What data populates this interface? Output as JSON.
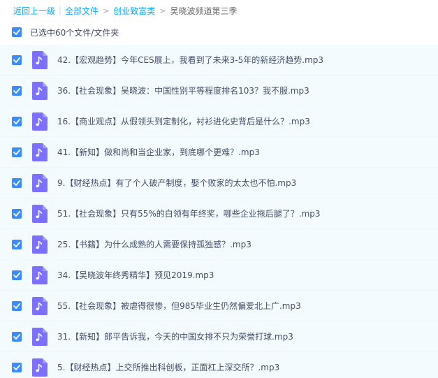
{
  "breadcrumb": {
    "back": "返回上一级",
    "all_files": "全部文件",
    "folder": "创业致富类",
    "current": "吴晓波频道第三季"
  },
  "selection": {
    "label": "已选中60个文件/文件夹"
  },
  "files": [
    {
      "name": "42.【宏观趋势】今年CES展上，我看到了未来3-5年的新经济趋势.mp3"
    },
    {
      "name": "36.【社会现象】吴晓波：中国性别平等程度排名103？我不服.mp3"
    },
    {
      "name": "16.【商业观点】从假领头到定制化，衬衫进化史背后是什么？.mp3"
    },
    {
      "name": "41.【新知】做和尚和当企业家，到底哪个更难？.mp3"
    },
    {
      "name": "9.【财经热点】有了个人破产制度，娶个败家的太太也不怕.mp3"
    },
    {
      "name": "51.【社会现象】只有55%的白领有年终奖，哪些企业拖后腿了？.mp3"
    },
    {
      "name": "25.【书籍】为什么成熟的人需要保持孤独感？.mp3"
    },
    {
      "name": "34.【吴晓波年终秀精华】预见2019.mp3"
    },
    {
      "name": "55.【社会现象】被虐得很惨，但985毕业生仍然偏爱北上广.mp3"
    },
    {
      "name": "31.【新知】郎平告诉我，今天的中国女排不只为荣誉打球.mp3"
    },
    {
      "name": "5.【财经热点】上交所推出科创板，正面杠上深交所？.mp3"
    }
  ],
  "colors": {
    "checkbox": "#3b8cff",
    "link": "#09aaff",
    "file_icon": "#7b70ff",
    "row_bg": "#f4fbff"
  },
  "icons": {
    "checkbox": "checkmark-icon",
    "file": "music-file-icon"
  }
}
